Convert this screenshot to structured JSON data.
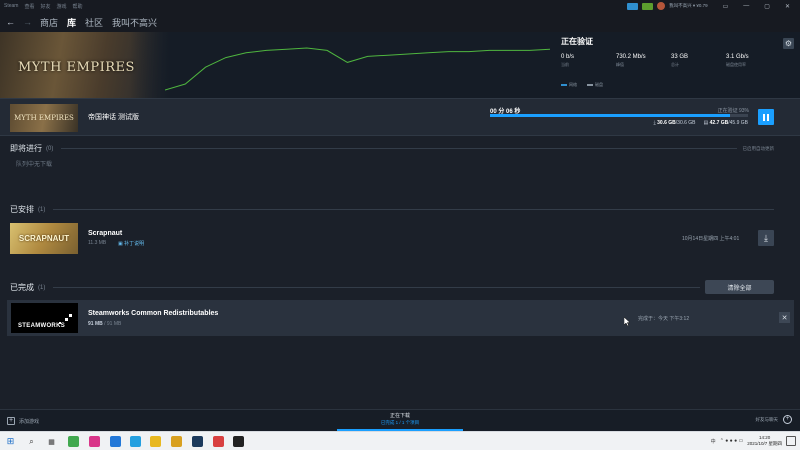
{
  "menubar": {
    "items": [
      "Steam",
      "查看",
      "好友",
      "游戏",
      "帮助"
    ],
    "account": "我叫不高兴 ▾ ¥0.79"
  },
  "window_controls": [
    "▭",
    "—",
    "▢",
    "✕"
  ],
  "nav": {
    "back": "←",
    "forward": "→",
    "tabs": [
      "商店",
      "库",
      "社区",
      "我叫不高兴"
    ],
    "active_tab": "库"
  },
  "banner": {
    "game_logo": "MYTH EMPIRES",
    "status": "正在验证",
    "stats": [
      {
        "value": "0 b/s",
        "label": "当前"
      },
      {
        "value": "730.2 Mb/s",
        "label": "峰值"
      },
      {
        "value": "33 GB",
        "label": "总计"
      },
      {
        "value": "3.1 Gb/s",
        "label": "磁盘使用率"
      }
    ],
    "legend": {
      "network": "网络",
      "disk": "磁盘"
    }
  },
  "active_download": {
    "name": "帝国神话 测试版",
    "time_remaining": "00 分 06 秒",
    "progress_text": "正在验证 93%",
    "progress_fraction": 0.93,
    "downloaded": "30.6 GB",
    "download_total": "/30.6 GB",
    "disk": "42.7 GB",
    "disk_total": "/45.9 GB"
  },
  "sections": {
    "upcoming": {
      "title": "即将进行",
      "count": "(0)",
      "right": "已启用自动更新",
      "empty_text": "队列中无下载"
    },
    "scheduled": {
      "title": "已安排",
      "count": "(1)"
    },
    "completed": {
      "title": "已完成",
      "count": "(1)",
      "clear_button": "清除全部"
    }
  },
  "scheduled_item": {
    "name": "Scrapnaut",
    "thumb_text": "SCRAPNAUT",
    "size": "11.3 MB",
    "notes": "补丁说明",
    "time": "10月14日星期四 上午4:01"
  },
  "completed_item": {
    "name": "Steamworks Common Redistributables",
    "thumb_text": "STEAMWORKS",
    "size_done": "91 MB",
    "size_total": " / 91 MB",
    "time": "完成于：今天 下午3:12",
    "remove": "✕"
  },
  "footer": {
    "add_game": "添加游戏",
    "status": "正在下载",
    "sub": "已完成 1 / 1 个项目",
    "friends": "好友与聊天"
  },
  "taskbar": {
    "ime": "中",
    "time": "14:20",
    "date": "2021/10/7 星期四"
  },
  "colors": {
    "accent": "#1a9fff",
    "graph_line": "#4fb63f",
    "background": "#1b2029"
  },
  "chart_data": {
    "type": "line",
    "series": [
      {
        "name": "网络",
        "values": [
          5,
          10,
          24,
          32,
          36,
          38,
          39,
          40,
          38,
          28,
          33,
          34,
          35,
          36,
          37,
          37,
          38,
          38,
          38,
          39
        ]
      }
    ],
    "ylim": [
      0,
      50
    ]
  }
}
